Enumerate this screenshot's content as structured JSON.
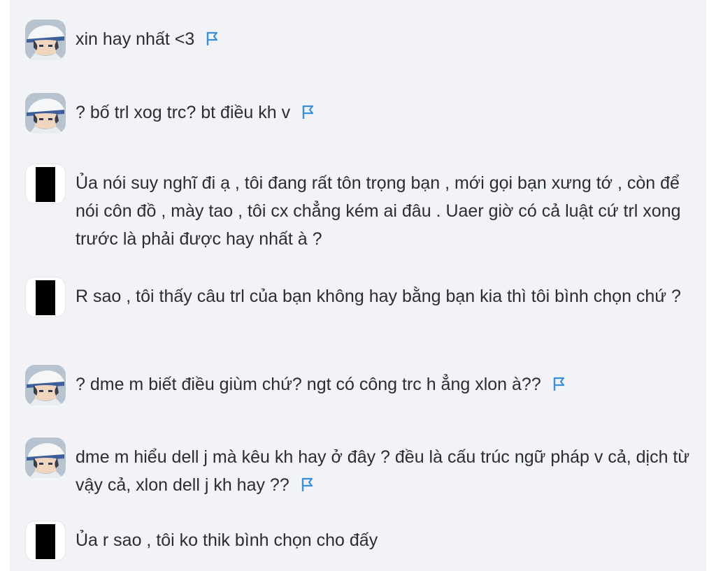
{
  "colors": {
    "panel_background": "#f1f3f7",
    "text": "#2b2d33",
    "flag": "#3a8fd9"
  },
  "comments": [
    {
      "text": "xin hay nhất <3",
      "avatar": "anime-character",
      "has_flag_icon": true
    },
    {
      "text": "? bố trl xog trc? bt điều kh v",
      "avatar": "anime-character",
      "has_flag_icon": true
    },
    {
      "text": "Ủa nói suy nghĩ đi ạ , tôi đang rất tôn trọng bạn , mới gọi bạn xưng tớ , còn để nói côn đồ , mày tao , tôi cx chẳng kém ai đâu . Uaer giờ có cả luật cứ trl xong trước là phải được hay nhất à ?",
      "avatar": "redacted",
      "has_flag_icon": false
    },
    {
      "text": "R sao , tôi thấy câu trl của bạn không hay bằng bạn kia thì tôi bình chọn chứ ?",
      "avatar": "redacted",
      "has_flag_icon": false
    },
    {
      "text": "? dme m biết điều giùm chứ? ngt có công trc h ẳng xlon à??",
      "avatar": "anime-character",
      "has_flag_icon": true
    },
    {
      "text": "dme m hiểu dell j mà kêu kh hay ở đây ? đều là cấu trúc ngữ pháp v cả, dịch từ vậy cả, xlon dell j kh hay ??",
      "avatar": "anime-character",
      "has_flag_icon": true
    },
    {
      "text": "Ủa r sao , tôi ko thik bình chọn cho đấy",
      "avatar": "redacted",
      "has_flag_icon": false
    }
  ]
}
